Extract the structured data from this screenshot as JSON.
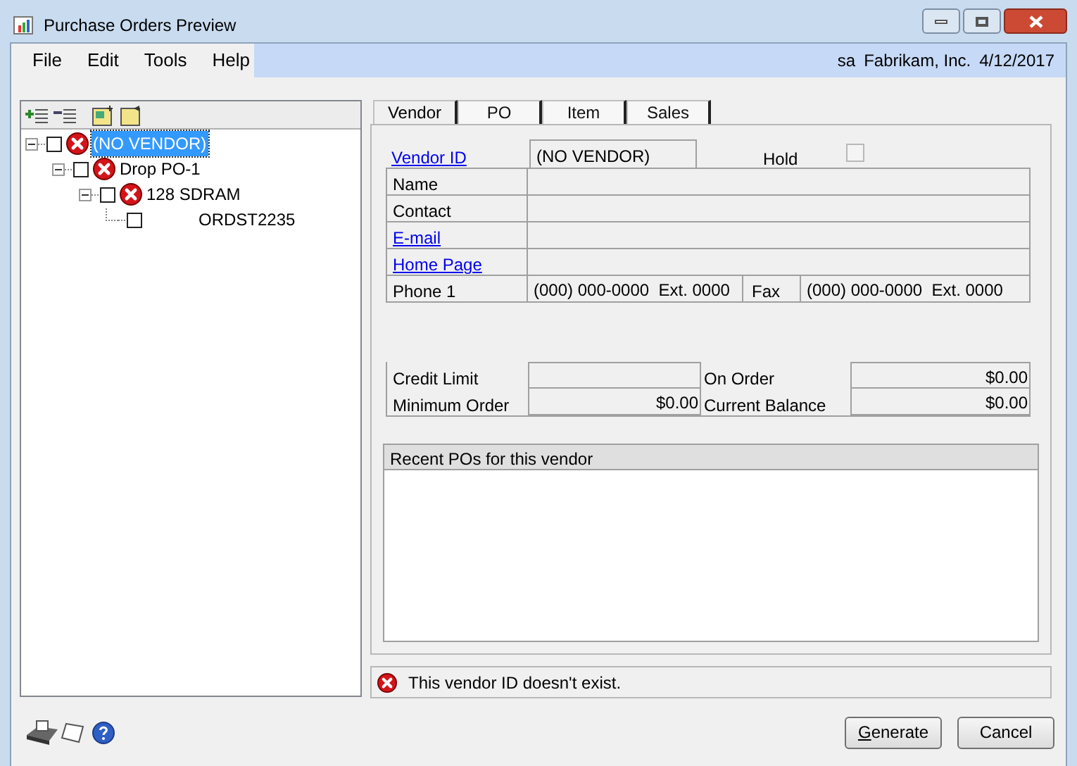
{
  "window": {
    "title": "Purchase Orders Preview"
  },
  "menu": [
    "File",
    "Edit",
    "Tools",
    "Help"
  ],
  "session": {
    "user": "sa",
    "company": "Fabrikam, Inc.",
    "date": "4/12/2017"
  },
  "tree": [
    {
      "label": "(NO VENDOR)",
      "checked": false,
      "error": true,
      "selected": true,
      "expanded": true,
      "children": [
        {
          "label": "Drop PO-1",
          "checked": false,
          "error": true,
          "selected": false,
          "expanded": true,
          "children": [
            {
              "label": "128 SDRAM",
              "checked": false,
              "error": true,
              "selected": false,
              "expanded": true,
              "children": [
                {
                  "label": "ORDST2235",
                  "checked": false,
                  "error": false,
                  "selected": false
                }
              ]
            }
          ]
        }
      ]
    }
  ],
  "tabs": [
    {
      "label": "Vendor",
      "selected": true
    },
    {
      "label": "PO",
      "selected": false
    },
    {
      "label": "Item",
      "selected": false
    },
    {
      "label": "Sales",
      "selected": false
    }
  ],
  "vendor_id": {
    "label": "Vendor ID",
    "kind": "link",
    "value": "(NO VENDOR)"
  },
  "hold": {
    "label": "Hold",
    "checked": false
  },
  "fields": [
    {
      "label": "Name",
      "kind": "plain"
    },
    {
      "label": "Contact",
      "kind": "plain"
    },
    {
      "label": "E-mail",
      "kind": "link"
    },
    {
      "label": "Home Page",
      "kind": "link"
    }
  ],
  "phone": {
    "label": "Phone 1",
    "value": "(000) 000-0000  Ext. 0000"
  },
  "fax": {
    "label": "Fax",
    "value": "(000) 000-0000  Ext. 0000"
  },
  "amounts": [
    [
      {
        "label": "Credit Limit"
      },
      {
        "label": "On Order",
        "value": "$0.00"
      }
    ],
    [
      {
        "label": "Minimum Order",
        "value": "$0.00"
      },
      {
        "label": "Current Balance",
        "value": "$0.00"
      }
    ]
  ],
  "recent_pos": {
    "title": "Recent POs for this vendor"
  },
  "status": {
    "message": "This vendor ID doesn't exist.",
    "error": true
  },
  "buttons": [
    {
      "label": "Generate",
      "mnemonic": true
    },
    {
      "label": "Cancel",
      "mnemonic": false
    }
  ]
}
